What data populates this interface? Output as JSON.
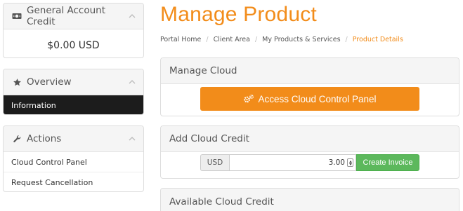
{
  "sidebar": {
    "credit_panel": {
      "title": "General Account Credit",
      "icon": "money-icon",
      "amount": "$0.00 USD"
    },
    "overview_panel": {
      "title": "Overview",
      "icon": "star-icon",
      "items": [
        {
          "label": "Information",
          "active": true
        }
      ]
    },
    "actions_panel": {
      "title": "Actions",
      "icon": "wrench-icon",
      "items": [
        {
          "label": "Cloud Control Panel"
        },
        {
          "label": "Request Cancellation"
        }
      ]
    }
  },
  "main": {
    "page_title": "Manage Product",
    "breadcrumb": [
      "Portal Home",
      "Client Area",
      "My Products & Services",
      "Product Details"
    ],
    "manage_cloud": {
      "title": "Manage Cloud",
      "button_label": "Access Cloud Control Panel",
      "button_icon": "cogs-icon"
    },
    "add_credit": {
      "title": "Add Cloud Credit",
      "currency": "USD",
      "amount_value": "3.00",
      "button_label": "Create Invoice"
    },
    "available_credit": {
      "title": "Available Cloud Credit"
    }
  },
  "colors": {
    "accent_orange": "#f28c1a",
    "success_green": "#5cb85c",
    "active_menu": "#1c1c1c"
  }
}
